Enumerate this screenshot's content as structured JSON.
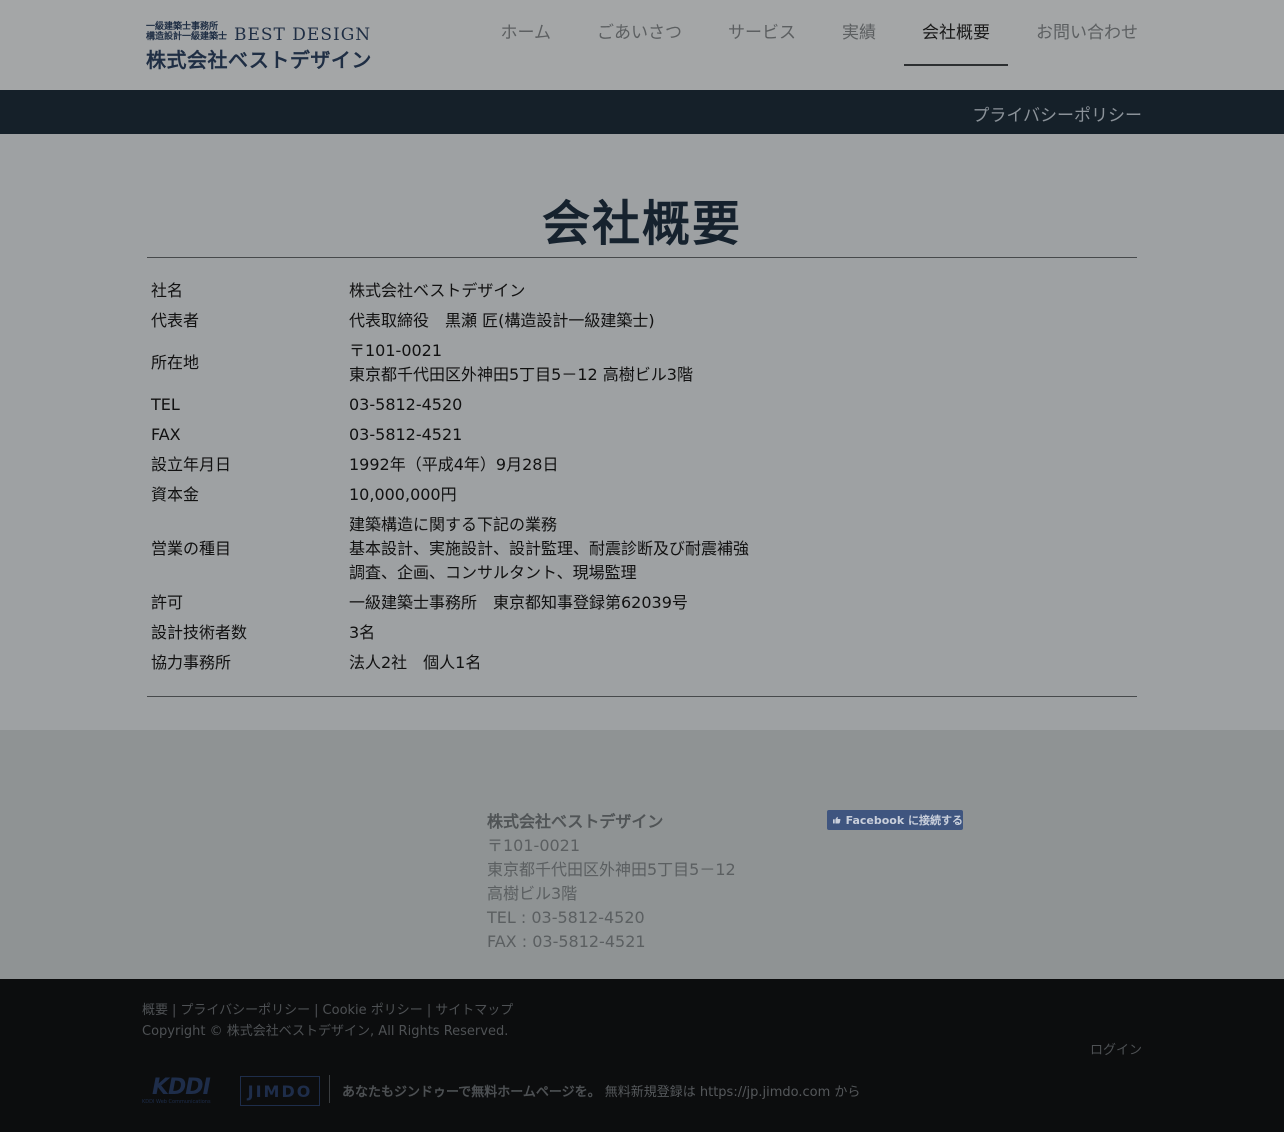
{
  "header": {
    "logo": {
      "line1": "一級建築士事務所",
      "line2": "構造設計一級建築士",
      "english": "BEST DESIGN",
      "japanese": "株式会社ベストデザイン"
    },
    "nav": [
      {
        "label": "ホーム"
      },
      {
        "label": "ごあいさつ"
      },
      {
        "label": "サービス"
      },
      {
        "label": "実績"
      },
      {
        "label": "会社概要",
        "active": true
      },
      {
        "label": "お問い合わせ"
      }
    ]
  },
  "subnav": {
    "privacy": "プライバシーポリシー"
  },
  "main": {
    "title": "会社概要",
    "rows": [
      {
        "label": "社名",
        "lines": [
          "株式会社ベストデザイン"
        ]
      },
      {
        "label": "代表者",
        "lines": [
          "代表取締役　黒瀬 匠(構造設計一級建築士)"
        ]
      },
      {
        "label": "所在地",
        "lines": [
          "〒101-0021",
          "東京都千代田区外神田5丁目5－12 高樹ビル3階"
        ]
      },
      {
        "label": "TEL",
        "lines": [
          "03-5812-4520"
        ]
      },
      {
        "label": "FAX",
        "lines": [
          "03-5812-4521"
        ]
      },
      {
        "label": "設立年月日",
        "lines": [
          "1992年（平成4年）9月28日"
        ]
      },
      {
        "label": "資本金",
        "lines": [
          "10,000,000円"
        ]
      },
      {
        "label": "営業の種目",
        "lines": [
          "建築構造に関する下記の業務",
          "基本設計、実施設計、設計監理、耐震診断及び耐震補強",
          "調査、企画、コンサルタント、現場監理"
        ]
      },
      {
        "label": "許可",
        "lines": [
          "一級建築士事務所　東京都知事登録第62039号"
        ]
      },
      {
        "label": "設計技術者数",
        "lines": [
          "3名"
        ]
      },
      {
        "label": "協力事務所",
        "lines": [
          "法人2社　個人1名"
        ]
      }
    ]
  },
  "footer": {
    "company": "株式会社ベストデザイン",
    "postal": "〒101-0021",
    "address1": "東京都千代田区外神田5丁目5－12",
    "address2": "高樹ビル3階",
    "tel": "TEL : 03-5812-4520",
    "fax": "FAX : 03-5812-4521",
    "facebook_button": "Facebook に接続する"
  },
  "bottom": {
    "links": [
      "概要",
      "プライバシーポリシー",
      "Cookie ポリシー",
      "サイトマップ"
    ],
    "separator": "|",
    "copyright": "Copyright © 株式会社ベストデザイン, All Rights Reserved.",
    "login": "ログイン",
    "kddi": "KDDI",
    "kddi_sub": "KDDI Web Communications",
    "jimdo": "JIMDO",
    "promo_bold": "あなたもジンドゥーで無料ホームページを。",
    "promo_text": "無料新規登録は",
    "promo_link": "https://jp.jimdo.com",
    "promo_suffix": "から"
  },
  "colors": {
    "accent_dark": "#152029",
    "logo_navy": "#1f2e44",
    "facebook": "#3f557f"
  }
}
